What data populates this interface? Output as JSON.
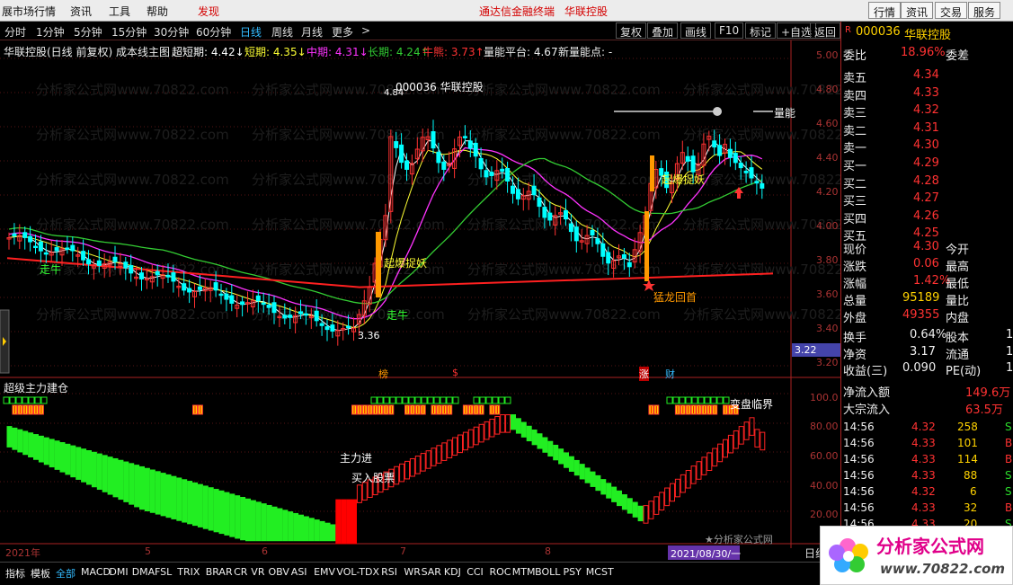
{
  "menubar": {
    "items": [
      "展市场行情",
      "资讯",
      "工具",
      "帮助"
    ],
    "highlight": "发现",
    "center_title": "通达信金融终端",
    "center_stock": "华联控股",
    "right_buttons": [
      "行情",
      "资讯",
      "交易",
      "服务"
    ]
  },
  "periods": {
    "items": [
      "分时",
      "1分钟",
      "5分钟",
      "15分钟",
      "30分钟",
      "60分钟",
      "日线",
      "周线",
      "月线",
      "更多"
    ],
    "active": "日线",
    "more_arrow": ">"
  },
  "toolbar": {
    "buttons": [
      "复权",
      "叠加",
      "画线",
      "F10",
      "标记",
      "+自选",
      "返回"
    ]
  },
  "indicator_line": {
    "prefix": "华联控股(日线 前复权) 成本线主图",
    "super_short": "超短期: 4.42↓",
    "short": "短期: 4.35↓",
    "mid": "中期: 4.31↓",
    "long": "长期: 4.24↑",
    "bull": "牛熊: 3.73↑",
    "platform": "量能平台: 4.67",
    "new_point": "新量能点: -"
  },
  "chart_labels": {
    "stock_tag": "000036 华联控股",
    "liangneng": "量能",
    "qibao1": "起爆捉妖",
    "qibao2": "起爆捉妖",
    "zouniu1": "走牛",
    "zouniu2": "走牛",
    "menglong": "猛龙回首",
    "low_price": "3.36",
    "high_price": "4.84",
    "cross_price": "3.22",
    "sub_title": "超级主力建仓",
    "zhuli_jin": "主力进",
    "mairu": "买入股票",
    "bianjie": "变盘临界",
    "watermark": "★分析家公式网",
    "date_left": "2021年",
    "date_cursor": "2021/08/30/一",
    "month_5": "5",
    "month_6": "6",
    "month_7": "7",
    "month_8": "8",
    "event_bang": "榜",
    "event_s": "$",
    "event_zhang": "涨",
    "event_cai": "财",
    "rixian": "日线"
  },
  "price_axis": [
    "5.00",
    "4.80",
    "4.60",
    "4.40",
    "4.20",
    "4.00",
    "3.80",
    "3.60",
    "3.40",
    "3.20"
  ],
  "sub_axis": [
    "100.0",
    "80.00",
    "60.00",
    "40.00",
    "20.00"
  ],
  "bottom_tabs": [
    "指标",
    "模板",
    "全部",
    "MACD",
    "DMI",
    "DMA",
    "FSL",
    "TRIX",
    "BRAR",
    "CR",
    "VR",
    "OBV",
    "ASI",
    "EMV",
    "VOL-TDX",
    "RSI",
    "WR",
    "SAR",
    "KDJ",
    "CCI",
    "ROC",
    "MTM",
    "BOLL",
    "PSY",
    "MCST"
  ],
  "bottom_active": "全部",
  "quote": {
    "code": "000036",
    "name": "华联控股",
    "r_mark": "R",
    "weibi_label": "委比",
    "weibi": "18.96%",
    "weicha_label": "委差",
    "asks": [
      {
        "label": "卖五",
        "price": "4.34"
      },
      {
        "label": "卖四",
        "price": "4.33"
      },
      {
        "label": "卖三",
        "price": "4.32"
      },
      {
        "label": "卖二",
        "price": "4.31"
      },
      {
        "label": "卖一",
        "price": "4.30"
      }
    ],
    "bids": [
      {
        "label": "买一",
        "price": "4.29"
      },
      {
        "label": "买二",
        "price": "4.28"
      },
      {
        "label": "买三",
        "price": "4.27"
      },
      {
        "label": "买四",
        "price": "4.26"
      },
      {
        "label": "买五",
        "price": "4.25"
      }
    ],
    "stats": [
      {
        "l1": "现价",
        "v1": "4.30",
        "l2": "今开"
      },
      {
        "l1": "涨跌",
        "v1": "0.06",
        "l2": "最高"
      },
      {
        "l1": "涨幅",
        "v1": "1.42%",
        "l2": "最低"
      },
      {
        "l1": "总量",
        "v1": "95189",
        "l2": "量比"
      },
      {
        "l1": "外盘",
        "v1": "49355",
        "l2": "内盘"
      }
    ],
    "stats2": [
      {
        "l1": "换手",
        "v1": "0.64%",
        "l2": "股本",
        "v2": "1"
      },
      {
        "l1": "净资",
        "v1": "3.17",
        "l2": "流通",
        "v2": "1"
      },
      {
        "l1": "收益(三)",
        "v1": "0.090",
        "l2": "PE(动)",
        "v2": "1"
      }
    ],
    "flow": [
      {
        "label": "净流入额",
        "value": "149.6万"
      },
      {
        "label": "大宗流入",
        "value": "63.5万"
      }
    ],
    "ticks": [
      {
        "time": "14:56",
        "price": "4.32",
        "vol": "258",
        "side": "S"
      },
      {
        "time": "14:56",
        "price": "4.33",
        "vol": "101",
        "side": "B"
      },
      {
        "time": "14:56",
        "price": "4.33",
        "vol": "114",
        "side": "B"
      },
      {
        "time": "14:56",
        "price": "4.33",
        "vol": "88",
        "side": "S"
      },
      {
        "time": "14:56",
        "price": "4.32",
        "vol": "6",
        "side": "S"
      },
      {
        "time": "14:56",
        "price": "4.33",
        "vol": "32",
        "side": "B"
      },
      {
        "time": "14:56",
        "price": "4.33",
        "vol": "20",
        "side": "S"
      }
    ]
  },
  "logo": {
    "text": "分析家公式网",
    "url": "www.70822.com"
  },
  "side_tab": "日线",
  "colors": {
    "up": "#ff3232",
    "down": "#00ffff",
    "ma_white": "#ffffff",
    "ma_yellow": "#ffff33",
    "ma_magenta": "#ff33ff",
    "ma_green": "#33cc33",
    "bull_line": "#ff2020",
    "signal_orange": "#ff9900"
  }
}
